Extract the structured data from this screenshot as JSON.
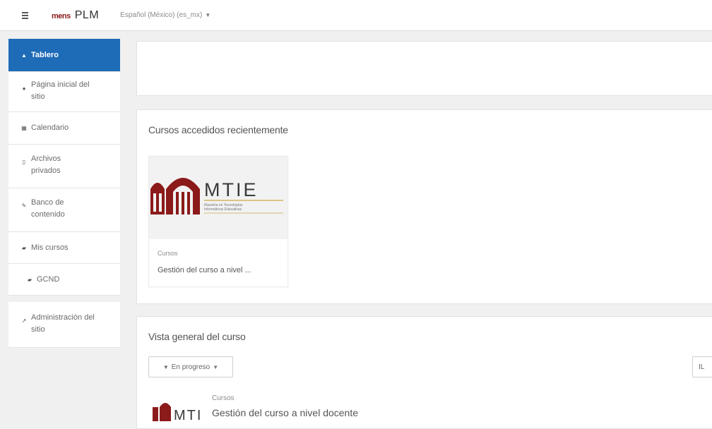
{
  "navbar": {
    "logo_text": "mens",
    "site_name": "PLM",
    "language": "Español (México) (es_mx)"
  },
  "sidebar": {
    "items": [
      {
        "label": "Tablero",
        "icon": "home-icon"
      },
      {
        "label": "Página inicial del sitio",
        "icon": "circle-icon"
      },
      {
        "label": "Calendario",
        "icon": "calendar-icon"
      },
      {
        "label": "Archivos privados",
        "icon": "file-icon"
      },
      {
        "label": "Banco de contenido",
        "icon": "pencil-icon"
      },
      {
        "label": "Mis cursos",
        "icon": "graduation-cap-icon"
      },
      {
        "label": "GCND",
        "icon": "graduation-cap-icon"
      },
      {
        "label": "Administración del sitio",
        "icon": "wrench-icon"
      }
    ]
  },
  "recent": {
    "title": "Cursos accedidos recientemente",
    "card": {
      "logo_text": "MTIE",
      "logo_subtitle": "Maestría en Tecnologías Informáticas Educativas",
      "category": "Cursos",
      "name": "Gestión del curso a nivel ..."
    }
  },
  "overview": {
    "title": "Vista general del curso",
    "filter_label": "En progreso",
    "sort_label": "IL",
    "course": {
      "logo_text": "MTI",
      "category": "Cursos",
      "name": "Gestión del curso a nivel docente"
    }
  },
  "colors": {
    "accent": "#1e6bb8",
    "brand": "#8b1a1a"
  }
}
